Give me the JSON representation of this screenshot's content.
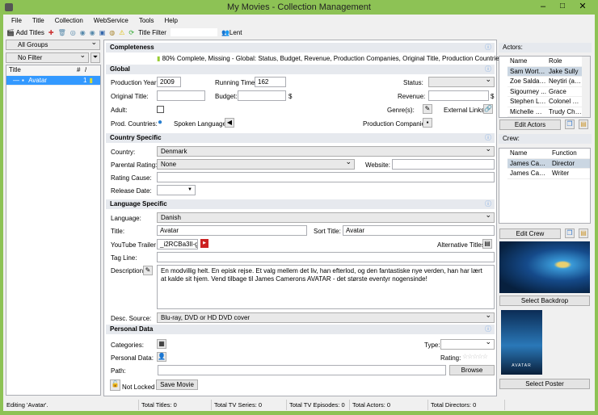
{
  "window": {
    "title": "My Movies - Collection Management"
  },
  "menu": [
    "File",
    "Title",
    "Collection",
    "WebService",
    "Tools",
    "Help"
  ],
  "toolbar": {
    "add_titles": "Add Titles",
    "title_filter_label": "Title Filter",
    "title_filter_value": "",
    "lent": "Lent"
  },
  "sidebar": {
    "group": "All Groups",
    "filter": "No Filter",
    "columns": [
      "Title",
      "#",
      "/"
    ],
    "items": [
      {
        "title": "Avatar",
        "count": "1"
      }
    ]
  },
  "completeness": {
    "header": "Completeness",
    "text": "80% Complete, Missing - Global: Status, Budget, Revenue, Production Companies, Original Title, Production Countries, Spoken"
  },
  "global": {
    "header": "Global",
    "production_year_label": "Production Year:",
    "production_year": "2009",
    "running_time_label": "Running Time:",
    "running_time": "162",
    "status_label": "Status:",
    "status": "",
    "original_title_label": "Original Title:",
    "original_title": "",
    "budget_label": "Budget:",
    "budget": "",
    "currency": "$",
    "revenue_label": "Revenue:",
    "revenue": "",
    "adult_label": "Adult:",
    "adult_checked": false,
    "genres_label": "Genre(s):",
    "external_links_label": "External Links:",
    "prod_countries_label": "Prod. Countries:",
    "spoken_languages_label": "Spoken Languages:",
    "production_companies_label": "Production Companies:"
  },
  "country": {
    "header": "Country Specific",
    "country_label": "Country:",
    "country": "Denmark",
    "parental_rating_label": "Parental Rating:",
    "parental_rating": "None",
    "website_label": "Website:",
    "website": "",
    "rating_cause_label": "Rating Cause:",
    "rating_cause": "",
    "release_date_label": "Release Date:",
    "release_date": ""
  },
  "language": {
    "header": "Language Specific",
    "language_label": "Language:",
    "language": "Danish",
    "title_label": "Title:",
    "title": "Avatar",
    "sort_title_label": "Sort Title:",
    "sort_title": "Avatar",
    "youtube_label": "YouTube Trailer ID:",
    "youtube": "_i2RCBa3Il-g",
    "alt_titles_label": "Alternative Titles:",
    "tag_line_label": "Tag Line:",
    "tag_line": "",
    "description_label": "Description:",
    "description": "En modvillig helt. En episk rejse. Et valg mellem det liv, han efterlod, og den fantastiske nye verden, han har lært at kalde sit hjem. Vend tilbage til James Camerons AVATAR - det største eventyr nogensinde!",
    "desc_source_label": "Desc. Source:",
    "desc_source": "Blu-ray, DVD or HD DVD cover"
  },
  "personal": {
    "header": "Personal Data",
    "categories_label": "Categories:",
    "type_label": "Type:",
    "type": "",
    "personal_data_label": "Personal Data:",
    "rating_label": "Rating:",
    "rating": 0,
    "path_label": "Path:",
    "path": "",
    "browse": "Browse",
    "lock_status": "Not Locked",
    "save": "Save Movie"
  },
  "actors": {
    "header": "Actors:",
    "columns": [
      "Name",
      "Role"
    ],
    "rows": [
      [
        "Sam Worthi...",
        "Jake Sully"
      ],
      [
        "Zoe Saldana",
        "Neytiri (as Z..."
      ],
      [
        "Sigourney ...",
        "Grace"
      ],
      [
        "Stephen Lang",
        "Colonel Mile..."
      ],
      [
        "Michelle Ro...",
        "Trudy Chacon"
      ]
    ],
    "edit": "Edit Actors"
  },
  "crew": {
    "header": "Crew:",
    "columns": [
      "Name",
      "Function"
    ],
    "rows": [
      [
        "James Cameron",
        "Director"
      ],
      [
        "James Cameron",
        "Writer"
      ]
    ],
    "edit": "Edit Crew"
  },
  "images": {
    "backdrop_button": "Select Backdrop",
    "poster_button": "Select Poster",
    "poster_text": "AVATAR"
  },
  "status": {
    "message": "Editing 'Avatar'.",
    "total_titles": "Total Titles: 0",
    "total_tv_series": "Total TV Series: 0",
    "total_tv_episodes": "Total TV Episodes: 0",
    "total_actors": "Total Actors: 0",
    "total_directors": "Total Directors: 0"
  }
}
